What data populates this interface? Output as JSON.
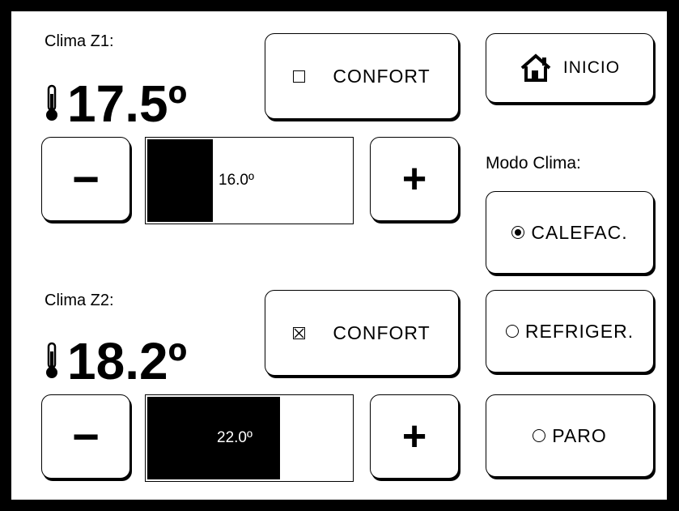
{
  "zone1": {
    "label": "Clima Z1:",
    "temperature": "17.5º",
    "confort_label": "CONFORT",
    "confort_checked": false,
    "setpoint": "16.0º",
    "setpoint_fill": 0.32,
    "minus_label": "−",
    "plus_label": "+"
  },
  "zone2": {
    "label": "Clima Z2:",
    "temperature": "18.2º",
    "confort_label": "CONFORT",
    "confort_checked": true,
    "setpoint": "22.0º",
    "setpoint_fill": 0.65,
    "minus_label": "−",
    "plus_label": "+"
  },
  "home": {
    "label": "INICIO"
  },
  "mode": {
    "title": "Modo Clima:",
    "options": [
      {
        "label": "CALEFAC.",
        "selected": true
      },
      {
        "label": "REFRIGER.",
        "selected": false
      },
      {
        "label": "PARO",
        "selected": false
      }
    ]
  },
  "icons": {
    "thermometer": "thermometer-icon",
    "home": "home-icon"
  }
}
